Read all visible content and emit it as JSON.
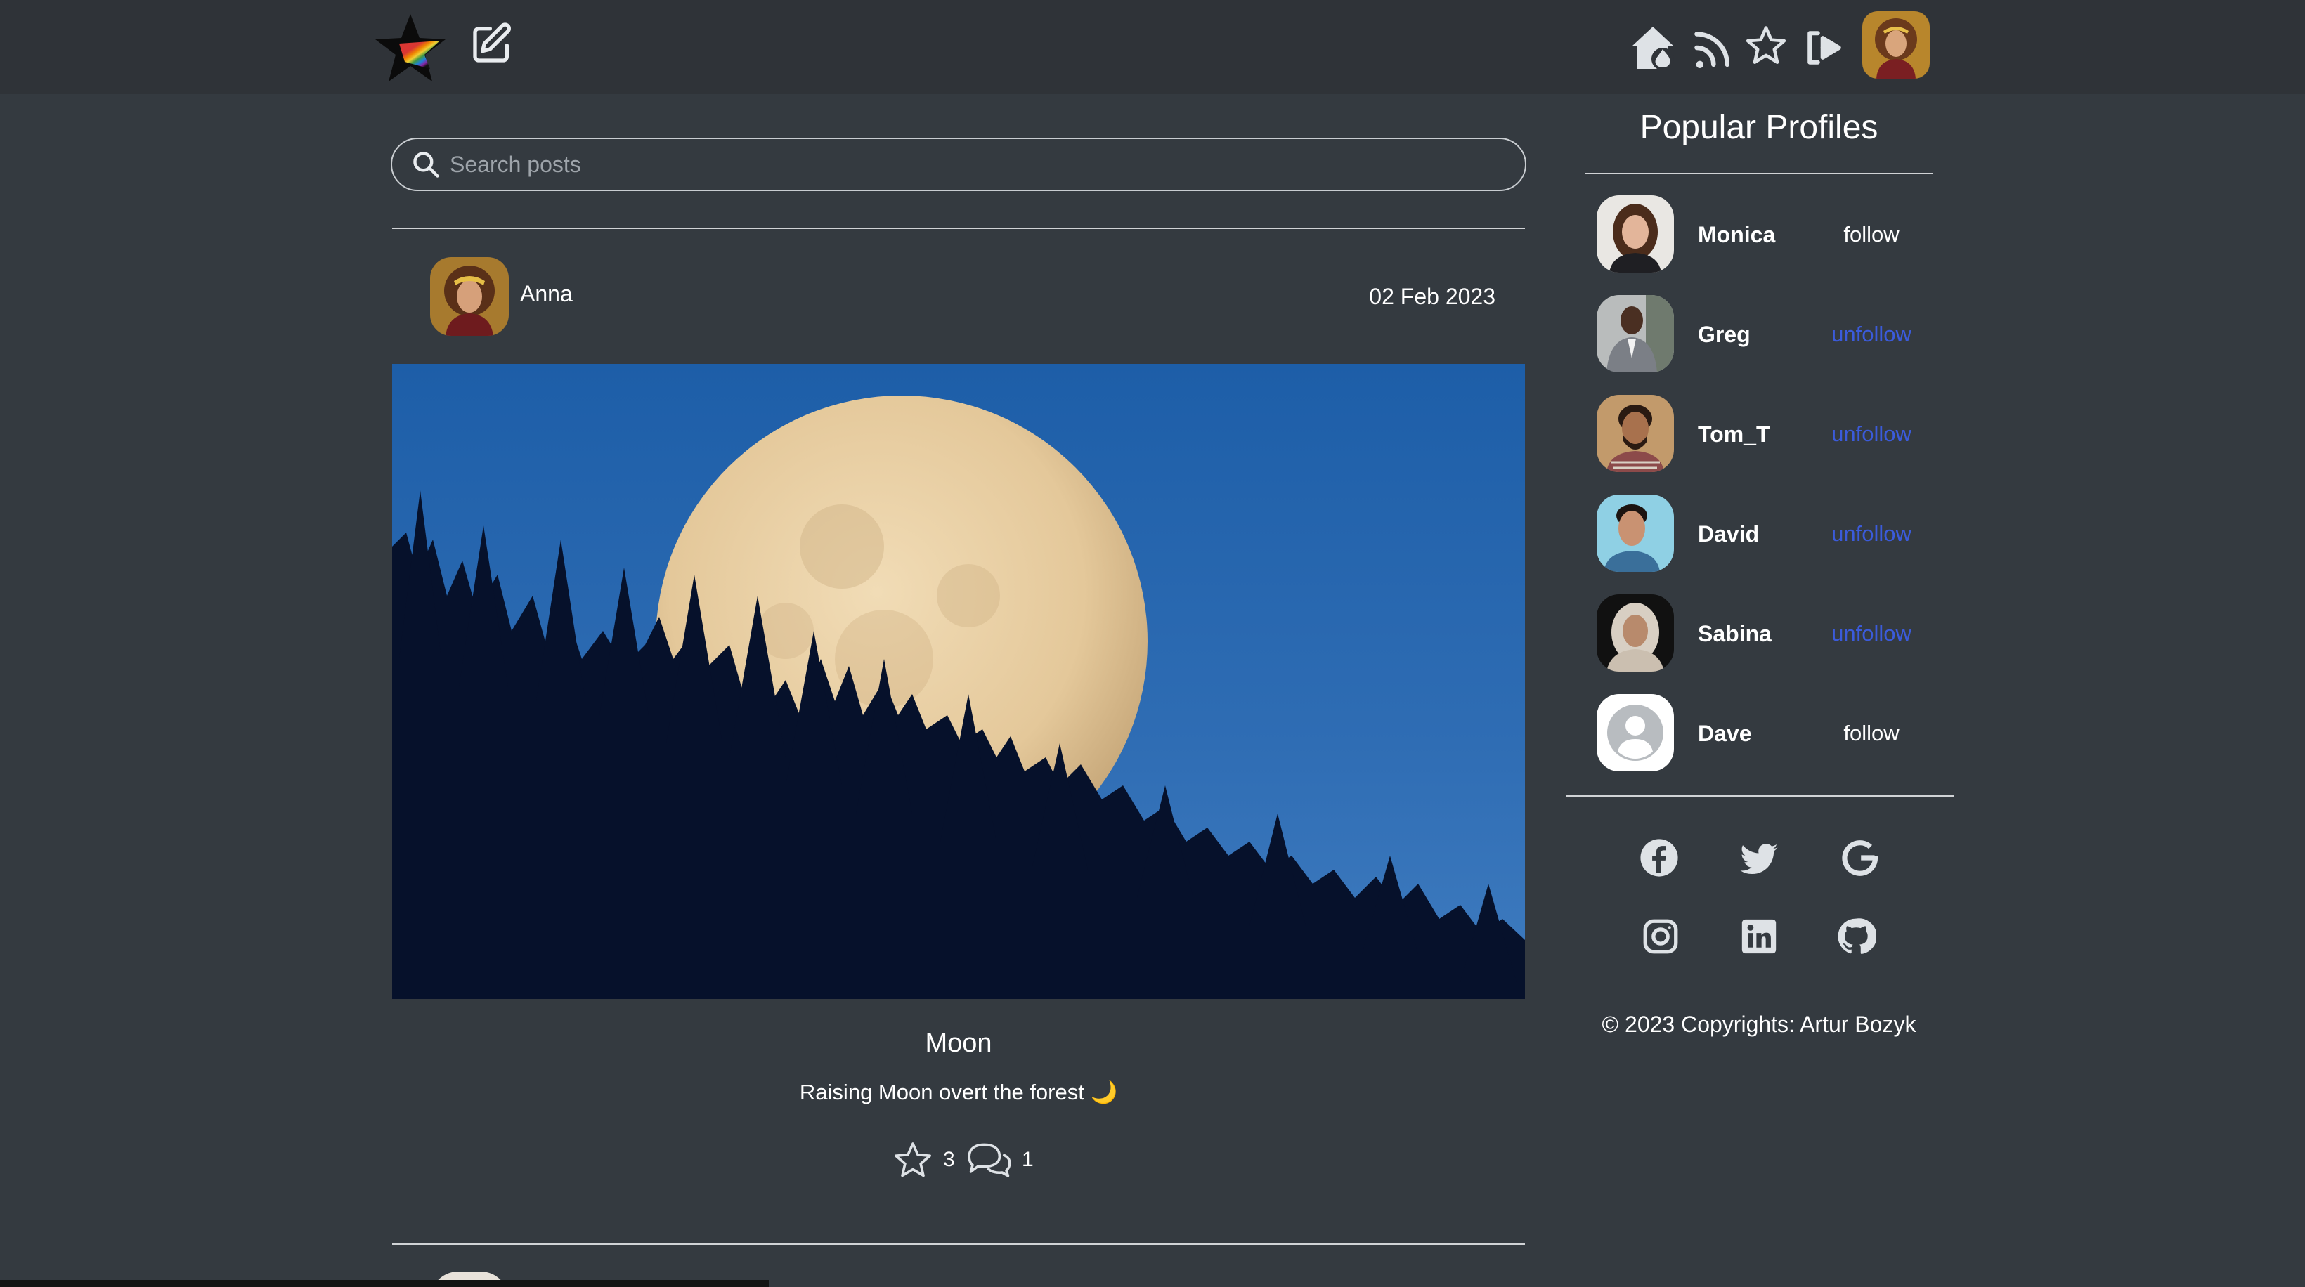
{
  "nav": {
    "brand_icon": "rainbow-star-logo",
    "left_icons": [
      "edit-icon"
    ],
    "right_icons": [
      "home-fire-icon",
      "rss-icon",
      "star-icon",
      "logout-icon"
    ],
    "avatar_alt": "current user avatar"
  },
  "search": {
    "placeholder": "Search posts",
    "value": ""
  },
  "post": {
    "author": "Anna",
    "date": "02 Feb 2023",
    "title": "Moon",
    "description": "Raising Moon overt the forest 🌙",
    "stars": "3",
    "comments": "1"
  },
  "sidebar": {
    "title": "Popular Profiles",
    "profiles": [
      {
        "name": "Monica",
        "action": "follow"
      },
      {
        "name": "Greg",
        "action": "unfollow"
      },
      {
        "name": "Tom_T",
        "action": "unfollow"
      },
      {
        "name": "David",
        "action": "unfollow"
      },
      {
        "name": "Sabina",
        "action": "unfollow"
      },
      {
        "name": "Dave",
        "action": "follow"
      }
    ],
    "social_icons": [
      "facebook-icon",
      "twitter-icon",
      "google-icon",
      "instagram-icon",
      "linkedin-icon",
      "github-icon"
    ],
    "copyright": "© 2023 Copyrights: Artur Bozyk"
  },
  "colors": {
    "background": "#343a40",
    "navbar": "#2f3338",
    "follow": "#ffffff",
    "unfollow": "#3b5bdb"
  }
}
